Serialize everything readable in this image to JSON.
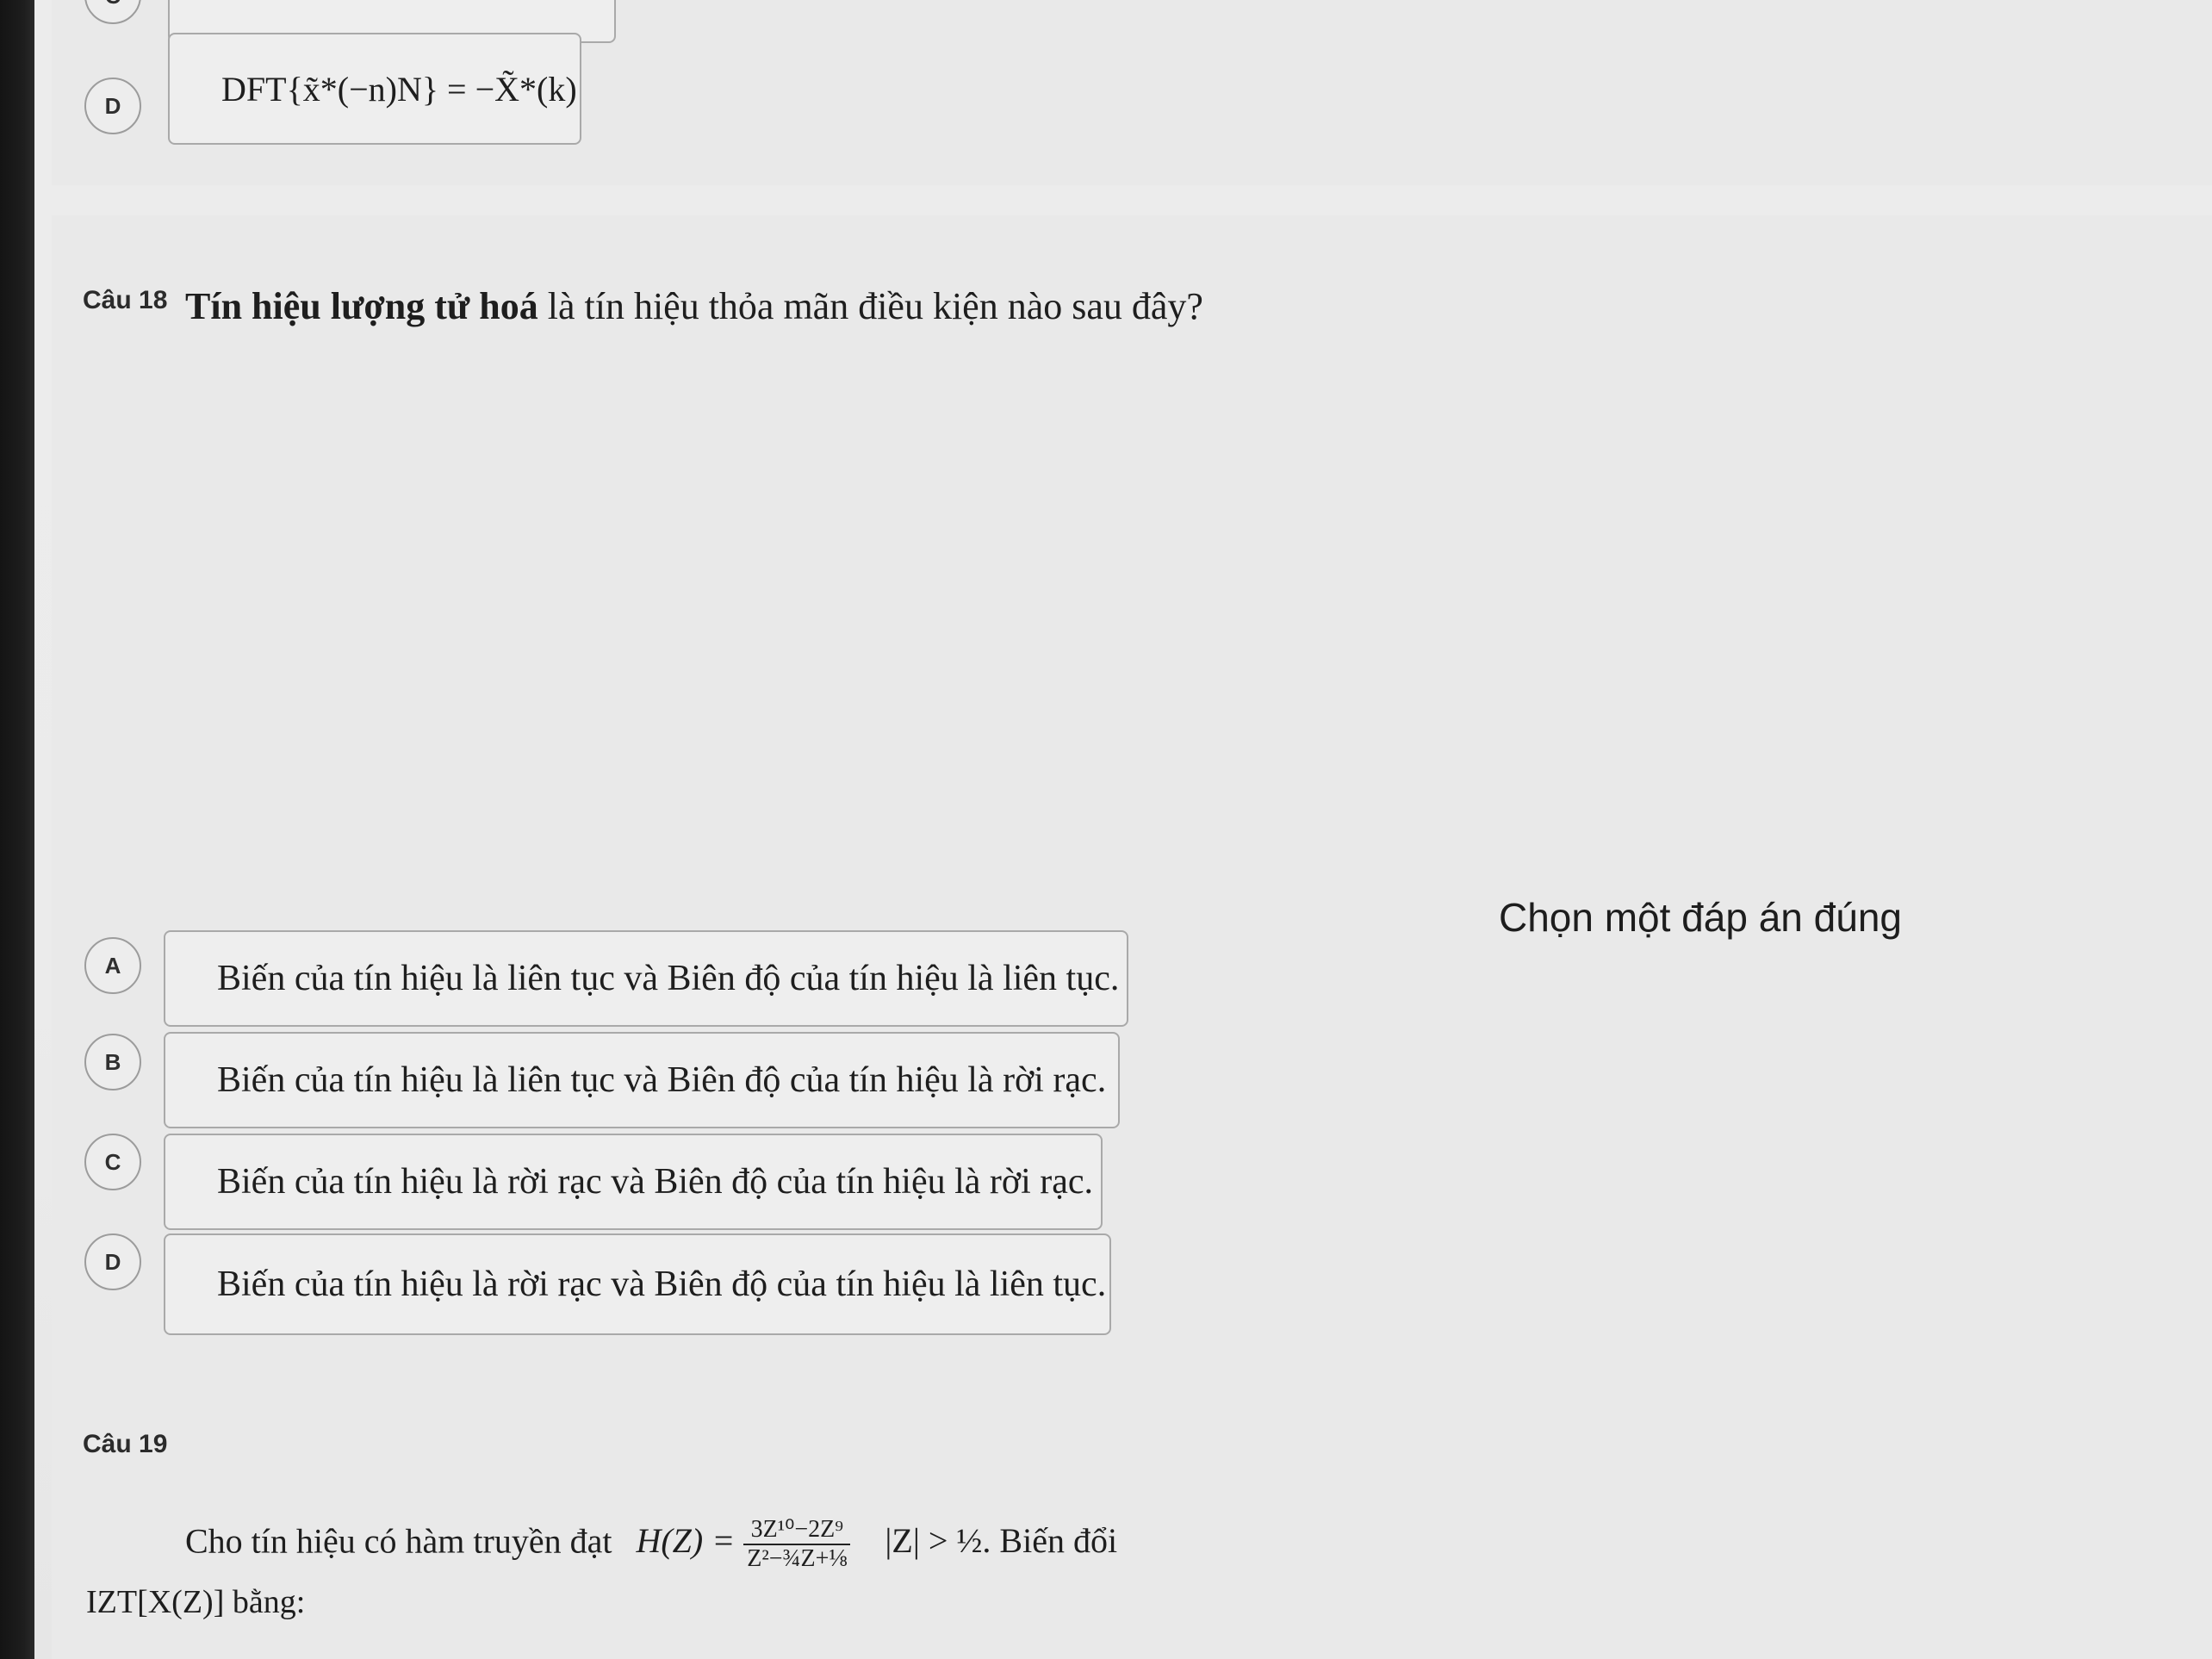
{
  "prev_question": {
    "partial_option_c_letter": "C",
    "option_d": {
      "letter": "D",
      "formula": "DFT{x̃*(−n)N} = −X̃*(k)"
    }
  },
  "question_18": {
    "number": "Câu 18",
    "text_bold": "Tín hiệu lượng tử hoá",
    "text_rest": " là tín hiệu thỏa mãn điều kiện nào sau đây?",
    "prompt": "Chọn một đáp án đúng",
    "options": [
      {
        "letter": "A",
        "text": "Biến của tín hiệu là liên tục và Biên độ của tín hiệu là liên tục."
      },
      {
        "letter": "B",
        "text": "Biến của tín hiệu là liên tục và Biên độ của tín hiệu là rời rạc."
      },
      {
        "letter": "C",
        "text": "Biến của tín hiệu là rời rạc và Biên độ của tín hiệu là rời rạc."
      },
      {
        "letter": "D",
        "text": "Biến của tín hiệu là rời rạc và Biên độ của tín hiệu là liên tục."
      }
    ]
  },
  "question_19": {
    "number": "Câu 19",
    "text": "Cho tín hiệu có hàm truyền đạt",
    "formula_lhs": "H(Z) =",
    "formula_num": "3Z¹⁰−2Z⁹",
    "formula_den": "Z²−¾Z+⅛",
    "condition": "|Z| > ½. Biến đổi",
    "second_line": "IZT[X(Z)] bằng:"
  }
}
